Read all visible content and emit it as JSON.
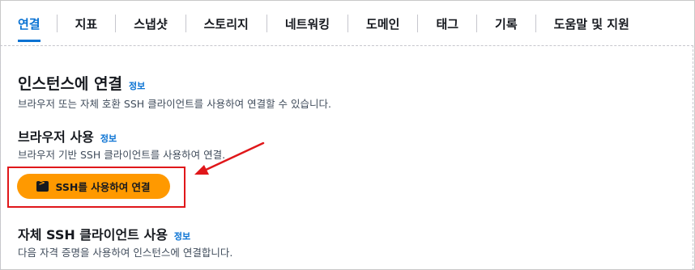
{
  "tabs": [
    {
      "label": "연결",
      "active": true
    },
    {
      "label": "지표"
    },
    {
      "label": "스냅샷"
    },
    {
      "label": "스토리지"
    },
    {
      "label": "네트워킹"
    },
    {
      "label": "도메인"
    },
    {
      "label": "태그"
    },
    {
      "label": "기록"
    },
    {
      "label": "도움말 및 지원"
    }
  ],
  "connect": {
    "title": "인스턴스에 연결",
    "info": "정보",
    "description": "브라우저 또는 자체 호환 SSH 클라이언트를 사용하여 연결할 수 있습니다."
  },
  "browser": {
    "title": "브라우저 사용",
    "info": "정보",
    "description": "브라우저 기반 SSH 클라이언트를 사용하여 연결.",
    "button_label": "SSH를 사용하여 연결",
    "button_icon": "terminal-icon"
  },
  "own_client": {
    "title": "자체 SSH 클라이언트 사용",
    "info": "정보",
    "description": "다음 자격 증명을 사용하여 인스턴스에 연결합니다."
  },
  "colors": {
    "accent": "#0972d3",
    "button": "#ff9900",
    "annotation": "#e0171a"
  }
}
